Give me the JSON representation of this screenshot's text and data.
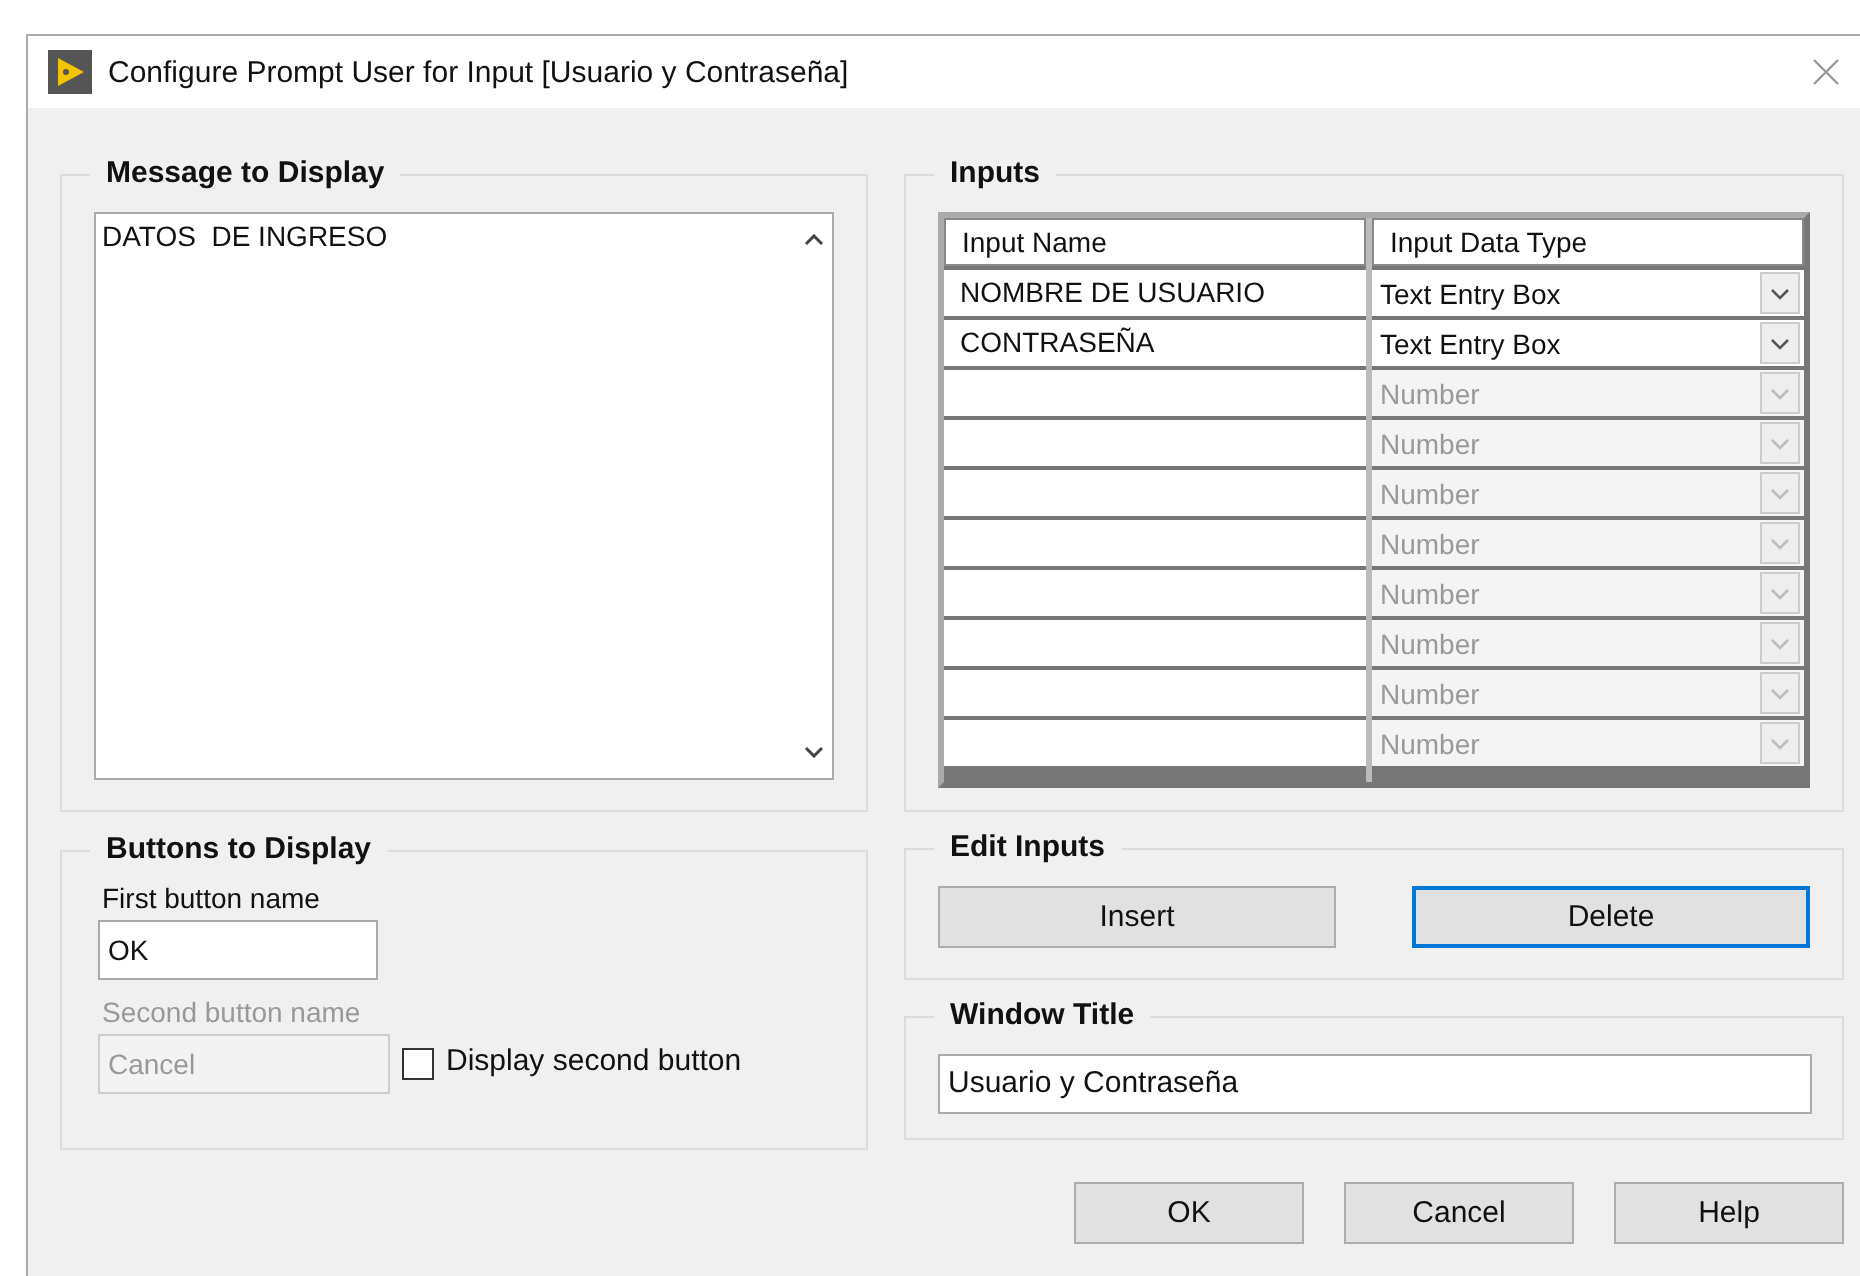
{
  "window": {
    "title": "Configure Prompt User for Input [Usuario y Contraseña]"
  },
  "message_group": {
    "title": "Message to Display",
    "text": "DATOS  DE INGRESO"
  },
  "buttons_group": {
    "title": "Buttons to Display",
    "first": {
      "label": "First button name",
      "value": "OK",
      "disabled": false
    },
    "second": {
      "label": "Second button name",
      "value": "Cancel",
      "disabled": true
    },
    "display_second": {
      "label": "Display second button",
      "checked": false
    }
  },
  "inputs_group": {
    "title": "Inputs",
    "columns": [
      "Input Name",
      "Input Data Type"
    ],
    "rows": [
      {
        "name": "NOMBRE DE USUARIO",
        "type": "Text Entry Box",
        "disabled": false
      },
      {
        "name": "CONTRASEÑA",
        "type": "Text Entry Box",
        "disabled": false
      },
      {
        "type": "Number",
        "disabled": true
      },
      {
        "type": "Number",
        "disabled": true
      },
      {
        "type": "Number",
        "disabled": true
      },
      {
        "type": "Number",
        "disabled": true
      },
      {
        "type": "Number",
        "disabled": true
      },
      {
        "type": "Number",
        "disabled": true
      },
      {
        "type": "Number",
        "disabled": true
      },
      {
        "type": "Number",
        "disabled": true
      }
    ]
  },
  "edit_group": {
    "title": "Edit Inputs",
    "buttons": [
      {
        "label": "Insert",
        "focused": false
      },
      {
        "label": "Delete",
        "focused": true
      }
    ]
  },
  "title_group": {
    "title": "Window Title",
    "value": "Usuario y Contraseña"
  },
  "dialog_buttons": [
    {
      "label": "OK"
    },
    {
      "label": "Cancel"
    },
    {
      "label": "Help"
    }
  ]
}
